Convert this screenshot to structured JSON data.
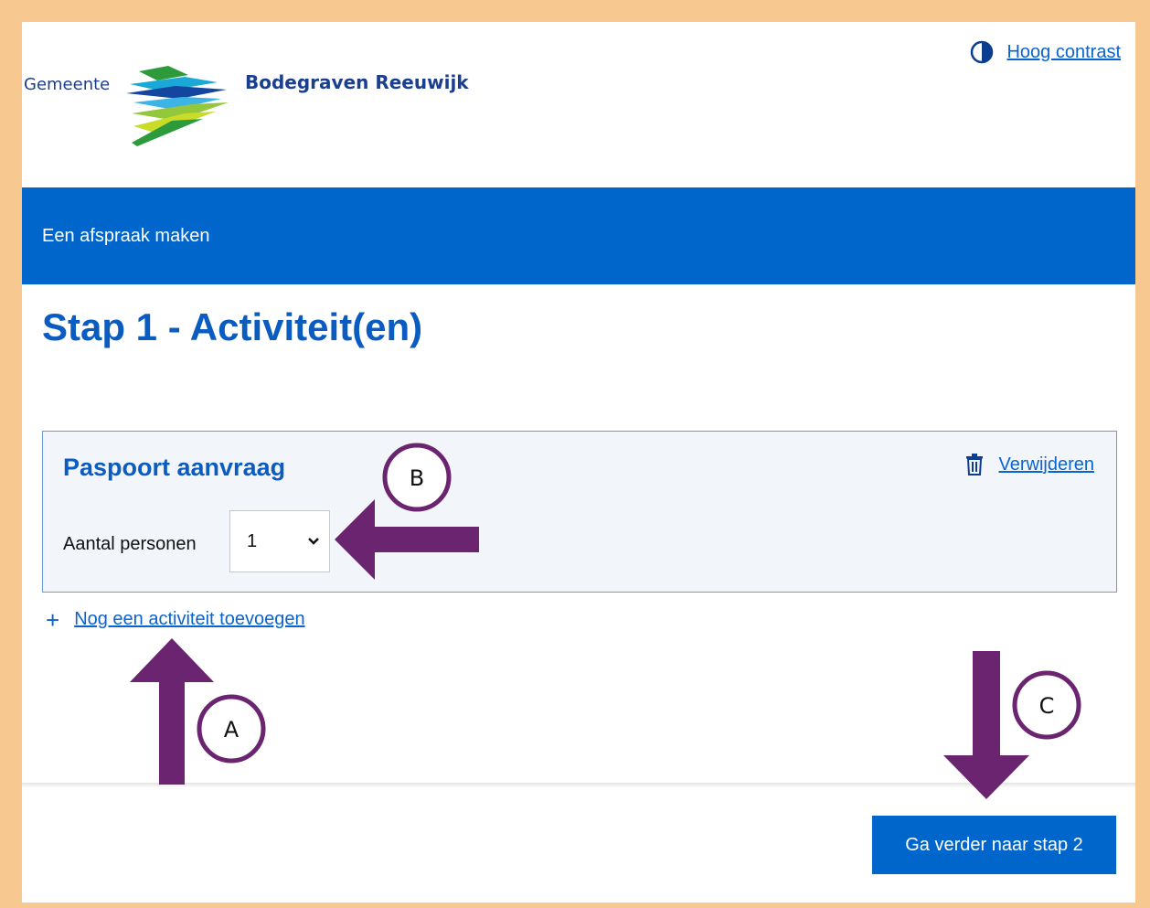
{
  "header": {
    "logo_prefix": "Gemeente",
    "logo_name": "Bodegraven Reeuwijk",
    "contrast_label": "Hoog contrast"
  },
  "band": {
    "title": "Een afspraak maken"
  },
  "page": {
    "title": "Stap 1 - Activiteit(en)"
  },
  "activity": {
    "title": "Paspoort aanvraag",
    "remove_label": "Verwijderen",
    "persons_label": "Aantal personen",
    "persons_value": "1"
  },
  "add_activity_label": "Nog een activiteit toevoegen",
  "footer": {
    "next_label": "Ga verder naar stap 2"
  },
  "annotations": {
    "a": "A",
    "b": "B",
    "c": "C"
  },
  "colors": {
    "brand_blue": "#0166cc",
    "link_blue": "#0a64d0",
    "frame_orange": "#f7c88f",
    "arrow_purple": "#6a2470"
  }
}
